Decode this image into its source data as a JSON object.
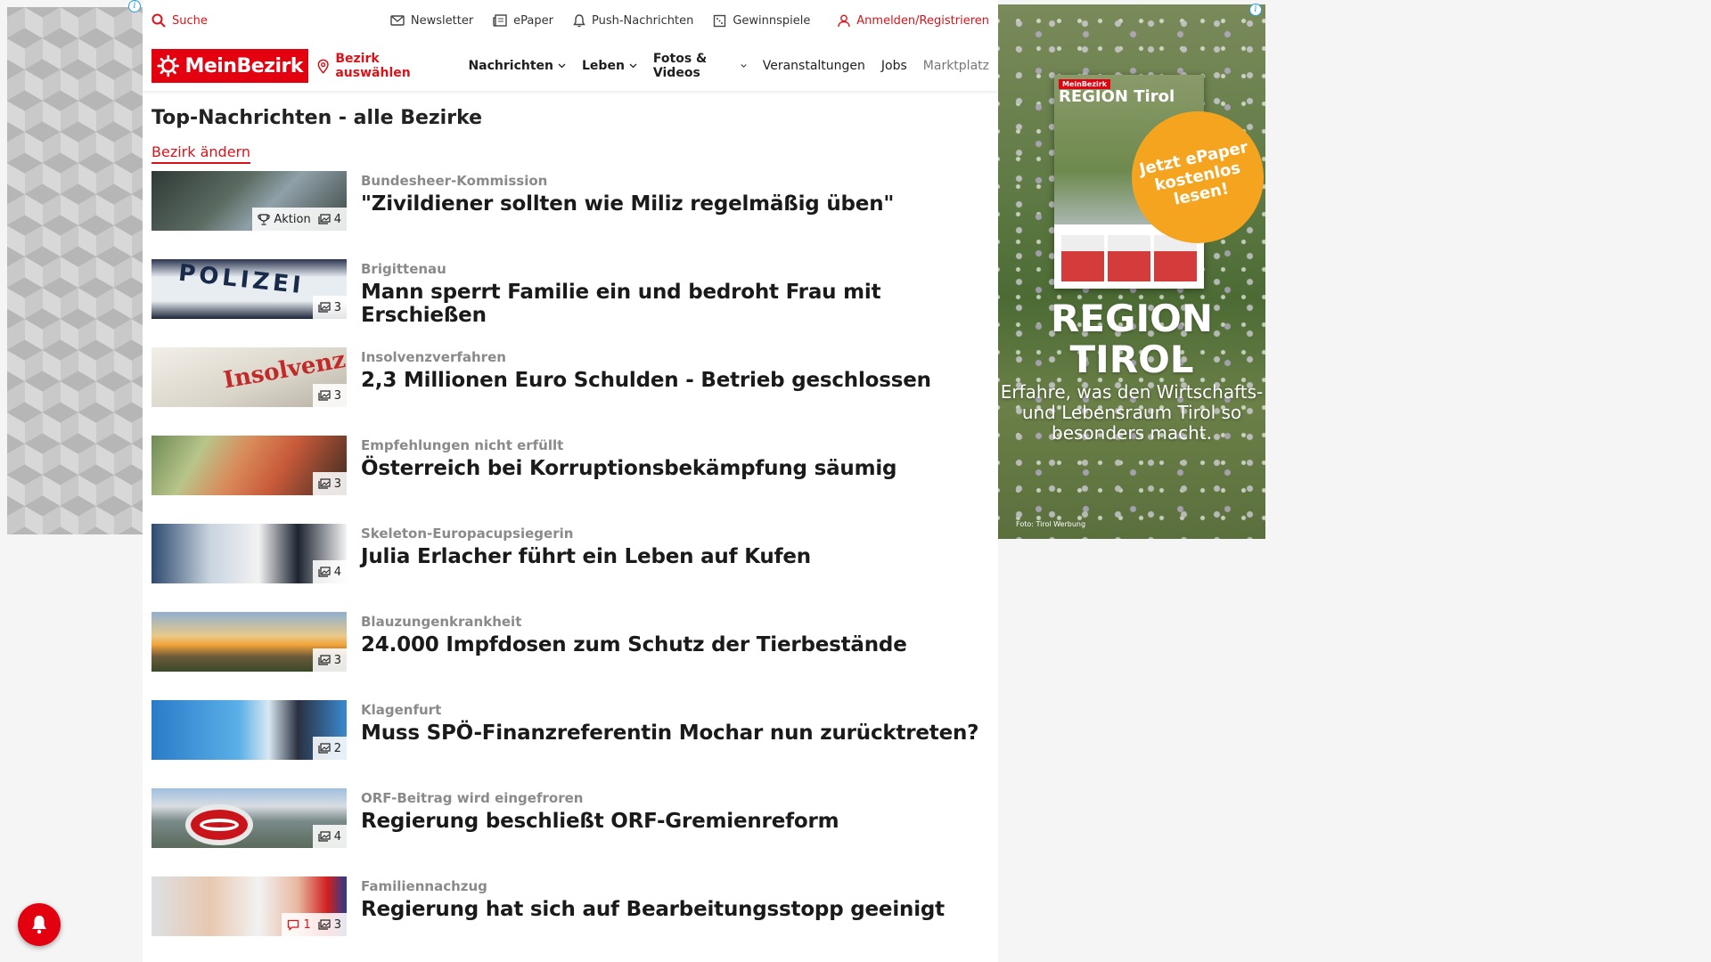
{
  "topbar": {
    "search": "Suche",
    "newsletter": "Newsletter",
    "epaper": "ePaper",
    "push": "Push-Nachrichten",
    "gewinnspiele": "Gewinnspiele",
    "login": "Anmelden/Registrieren"
  },
  "navbar": {
    "logo": "MeinBezirk",
    "bezirk_select": "Bezirk auswählen",
    "items": [
      {
        "label": "Nachrichten"
      },
      {
        "label": "Leben"
      },
      {
        "label": "Fotos & Videos"
      },
      {
        "label": "Veranstaltungen"
      },
      {
        "label": "Jobs"
      },
      {
        "label": "Marktplatz"
      }
    ]
  },
  "main": {
    "title": "Top-Nachrichten - alle Bezirke",
    "change_bezirk": "Bezirk ändern",
    "articles": [
      {
        "kicker": "Bundesheer-Kommission",
        "headline": "\"Zivildiener sollten wie Miliz regelmäßig üben\"",
        "action": "Aktion",
        "photos": "4"
      },
      {
        "kicker": "Brigittenau",
        "headline": "Mann sperrt Familie ein und bedroht Frau mit Erschießen",
        "photos": "3",
        "thumb_text": "POLIZEI"
      },
      {
        "kicker": "Insolvenzverfahren",
        "headline": "2,3 Millionen Euro Schulden - Betrieb geschlossen",
        "photos": "3",
        "thumb_text": "Insolvenz."
      },
      {
        "kicker": "Empfehlungen nicht erfüllt",
        "headline": "Österreich bei Korruptionsbekämpfung säumig",
        "photos": "3"
      },
      {
        "kicker": "Skeleton-Europacupsiegerin",
        "headline": "Julia Erlacher führt ein Leben auf Kufen",
        "photos": "4"
      },
      {
        "kicker": "Blauzungenkrankheit",
        "headline": "24.000 Impfdosen zum Schutz der Tierbestände",
        "photos": "3"
      },
      {
        "kicker": "Klagenfurt",
        "headline": "Muss SPÖ-Finanzreferentin Mochar nun zurücktreten?",
        "photos": "2"
      },
      {
        "kicker": "ORF-Beitrag wird eingefroren",
        "headline": "Regierung beschließt ORF-Gremienreform",
        "photos": "4"
      },
      {
        "kicker": "Familiennachzug",
        "headline": "Regierung hat sich auf Bearbeitungsstopp geeinigt",
        "comments": "1",
        "photos": "3"
      }
    ]
  },
  "ad_right": {
    "mag_logo": "MeinBezirk",
    "mag_title": "REGION Tirol",
    "cta": "Jetzt ePaper kostenlos lesen!",
    "brand_line1": "REGION",
    "brand_line2": "TIROL",
    "tagline": "Erfahre, was den Wirtschafts- und Lebensraum Tirol so besonders macht.",
    "credit": "Foto: Tirol Werbung"
  },
  "colors": {
    "brand_red": "#e3000f",
    "accent_red": "#d7141a",
    "ad_orange": "#f4a41f"
  }
}
